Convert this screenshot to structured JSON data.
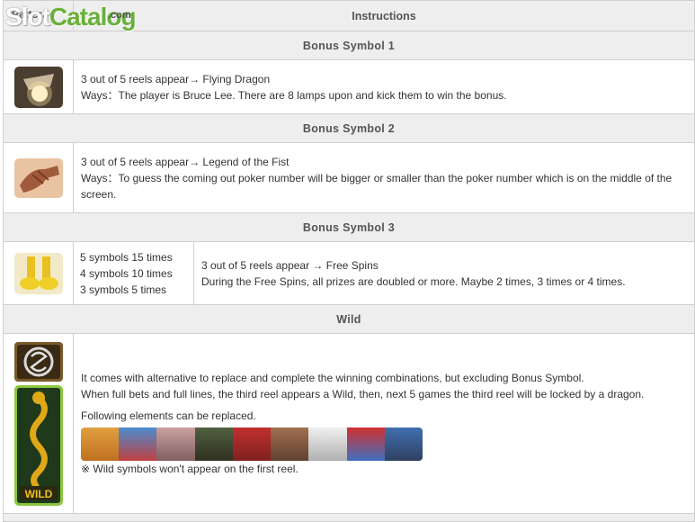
{
  "header": {
    "pattern": "Pattern",
    "instructions": "Instructions"
  },
  "watermark": {
    "slot": "Slot",
    "catalog": "Catalog",
    "com": ".com"
  },
  "sections": [
    {
      "title": "Bonus Symbol 1",
      "line1": "3 out of 5 reels appear→ Flying Dragon",
      "line2": "Ways：The player is Bruce Lee. There are 8 lamps upon and kick them to win the bonus."
    },
    {
      "title": "Bonus Symbol 2",
      "line1": "3 out of 5 reels appear→ Legend of the Fist",
      "line2": "Ways：To guess the coming out poker number will be bigger or smaller than the poker number which is on the middle of the screen."
    },
    {
      "title": "Bonus Symbol 3",
      "pays": [
        "5 symbols 15 times",
        "4 symbols 10 times",
        "3 symbols 5 times"
      ],
      "line1": "3 out of 5 reels appear → Free Spins",
      "line2": "During the Free Spins, all prizes are doubled or more. Maybe 2 times, 3 times or 4 times."
    },
    {
      "title": "Wild",
      "line1": "It comes with alternative to replace and complete the winning combinations, but excluding Bonus Symbol.",
      "line2": "When full bets and full lines, the third reel appears a Wild, then, next 5 games the third reel will be locked by a dragon.",
      "line3": "Following elements can be replaced.",
      "note": "※ Wild symbols won't appear on the first reel.",
      "wild_label": "WILD"
    }
  ],
  "icons": {
    "lamp": "lamp-icon",
    "hand": "hand-icon",
    "feet": "yellow-shoes-icon",
    "dragon_medallion": "dragon-medallion-icon",
    "wild": "golden-dragon-wild-icon"
  },
  "colors": {
    "header_bg": "#eeeeee",
    "border": "#cfcfcf",
    "brand_green": "#6ab03a"
  }
}
